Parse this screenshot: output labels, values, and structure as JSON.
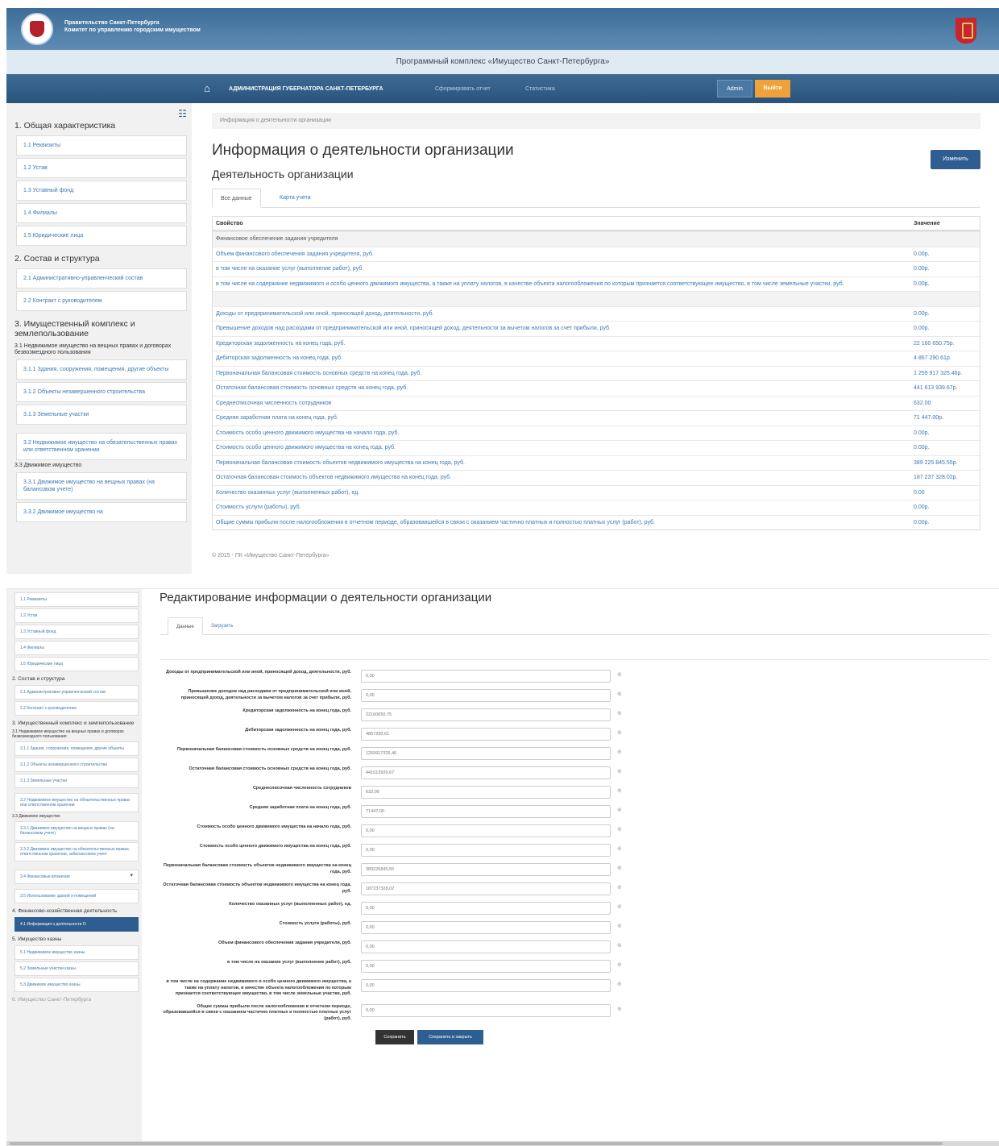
{
  "header": {
    "gov_line1": "Правительство Санкт-Петербурга",
    "gov_line2": "Комитет по управлению городским имуществом",
    "app_title": "Программный комплекс «Имущество Санкт-Петербурга»"
  },
  "nav": {
    "org": "АДМИНИСТРАЦИЯ ГУБЕРНАТОРА САНКТ-ПЕТЕРБУРГА",
    "link1": "Сформировать отчет",
    "link2": "Статистика",
    "admin": "Admin",
    "logout": "Выйти"
  },
  "sidebar": {
    "s1": "1. Общая характеристика",
    "s1_items": [
      "1.1 Реквизиты",
      "1.2 Устав",
      "1.3 Уставный фонд",
      "1.4 Филиалы",
      "1.5 Юридические лица"
    ],
    "s2": "2. Состав и структура",
    "s2_items": [
      "2.1 Административно-управленческий состав",
      "2.2 Контракт с руководителем"
    ],
    "s3": "3. Имущественный комплекс и землепользование",
    "s3_sub": "3.1 Недвижимое имущество на вещных правах и договорах безвозмездного пользования",
    "s3_items": [
      "3.1.1 Здания, сооружения, помещения, другие объекты",
      "3.1.2 Объекты незавершенного строительства",
      "3.1.3 Земельные участки"
    ],
    "s3_2": "3.2 Недвижимое имущество на обязательственных правах или ответственном хранении",
    "s3_3": "3.3 Движимое имущество",
    "s3_3_items": [
      "3.3.1 Движимое имущество на вещных правах (на балансовом учете)",
      "3.3.2 Движимое имущество на"
    ]
  },
  "main": {
    "breadcrumb": "Информация о деятельности организации",
    "title": "Информация о деятельности организации",
    "edit_button": "Изменить",
    "subtitle": "Деятельность организации",
    "tab_all": "Все данные",
    "tab_card": "Карта учета",
    "col_prop": "Свойство",
    "col_val": "Значение",
    "rows": [
      {
        "p": "Финансовое обеспечение задания учредителя",
        "v": "",
        "group": true
      },
      {
        "p": "Объем финансового обеспечения задания учредителя, руб.",
        "v": "0.00р."
      },
      {
        "p": "в том числе на оказание услуг (выполнение работ), руб.",
        "v": "0.00р."
      },
      {
        "p": "в том числе на содержание недвижимого и особо ценного движимого имущества, а также на уплату налогов, в качестве объекта налогообложения по которым признается соответствующее имущество, в том числе земельные участки, руб.",
        "v": "0.00р."
      },
      {
        "p": "",
        "v": "",
        "group": true
      },
      {
        "p": "Доходы от предпринимательской или иной, приносящей доход, деятельности, руб.",
        "v": "0.00р."
      },
      {
        "p": "Превышение доходов над расходами от предпринимательской или иной, приносящей доход, деятельности за вычетом налогов за счет прибыли, руб.",
        "v": "0.00р."
      },
      {
        "p": "Кредиторская задолженность на конец года, руб.",
        "v": "22 160 650.75р."
      },
      {
        "p": "Дебиторская задолженность на конец года, руб.",
        "v": "4 867 290.61р."
      },
      {
        "p": "Первоначальная балансовая стоимость основных средств на конец года, руб.",
        "v": "1 259 917 325.46р."
      },
      {
        "p": "Остаточная балансовая стоимость основных средств на конец года, руб.",
        "v": "441 613 939.67р."
      },
      {
        "p": "Среднесписочная численность сотрудников",
        "v": "632.00"
      },
      {
        "p": "Средняя заработная плата на конец года, руб.",
        "v": "71 447.00р."
      },
      {
        "p": "Стоимость особо ценного движимого имущества на начало года, руб.",
        "v": "0.00р."
      },
      {
        "p": "Стоимость особо ценного движимого имущества на конец года, руб.",
        "v": "0.00р."
      },
      {
        "p": "Первоначальная балансовая стоимость объектов недвижимого имущества на конец года, руб.",
        "v": "389 225 845.55р."
      },
      {
        "p": "Остаточная балансовая стоимость объектов недвижимого имущества на конец года, руб.",
        "v": "187 237 328.02р."
      },
      {
        "p": "Количество оказанных услуг (выполненных работ), ед.",
        "v": "0.00"
      },
      {
        "p": "Стоимость услуги (работы), руб.",
        "v": "0.00р."
      },
      {
        "p": "Общие суммы прибыли после налогообложения в отчетном периоде, образовавшейся в связи с оказанием частично платных и полностью платных услуг (работ), руб.",
        "v": "0.00р."
      }
    ],
    "footer": "© 2015 - ПК «Имущество Санкт-Петербурга»"
  },
  "sidebar2": {
    "s1_items": [
      "1.1 Реквизиты",
      "1.2 Устав",
      "1.3 Уставный фонд",
      "1.4 Филиалы",
      "1.5 Юридические лица"
    ],
    "s2": "2. Состав и структура",
    "s2_items": [
      "2.1 Административно-управленческий состав",
      "2.2 Контракт с руководителем"
    ],
    "s3": "3. Имущественный комплекс и землепользование",
    "s3_sub": "3.1 Недвижимое имущество на вещных правах и договорах безвозмездного пользования",
    "s3_items": [
      "3.1.1 Здания, сооружения, помещения, другие объекты",
      "3.1.2 Объекты незавершенного строительства",
      "3.1.3 Земельные участки"
    ],
    "s3_2": "3.2 Недвижимое имущество на обязательственных правах или ответственном хранении",
    "s3_3": "3.3 Движимое имущество",
    "s3_3_items": [
      "3.3.1 Движимое имущество на вещных правах (на балансовом учете)",
      "3.3.2 Движимое имущество на обязательственных правах, ответственном хранении, забалансовом учете"
    ],
    "s3_4": "3.4 Финансовые вложения",
    "s3_5": "3.5 Использование зданий и помещений",
    "s4": "4. Финансово-хозяйственная деятельность",
    "s4_active": "4.1 Информация о деятельности О",
    "s5": "5. Имущество казны",
    "s5_items": [
      "5.1 Недвижимое имущество казны",
      "5.2 Земельные участки казны",
      "5.3 Движимое имущество казны"
    ],
    "cut": "6. Имущество Санкт-Петербурга"
  },
  "form": {
    "title": "Редактирование информации о деятельности организации",
    "tab_main": "Данные",
    "tab_upload": "Загрузить",
    "fields": [
      {
        "label": "Доходы от предпринимательской или иной, приносящей доход, деятельности, руб.",
        "value": "0,00"
      },
      {
        "label": "Превышение доходов над расходами от предпринимательской или иной, приносящей доход, деятельности за вычетом налогов за счет прибыли, руб.",
        "value": "0,00"
      },
      {
        "label": "Кредиторская задолженность на конец года, руб.",
        "value": "22160650,75"
      },
      {
        "label": "Дебиторская задолженность на конец года, руб.",
        "value": "4867290,61"
      },
      {
        "label": "Первоначальная балансовая стоимость основных средств на конец года, руб.",
        "value": "1259917325,46"
      },
      {
        "label": "Остаточная балансовая стоимость основных средств на конец года, руб.",
        "value": "441613939,67"
      },
      {
        "label": "Среднесписочная численность сотрудников",
        "value": "632,00"
      },
      {
        "label": "Средняя заработная плата на конец года, руб.",
        "value": "71447,00"
      },
      {
        "label": "Стоимость особо ценного движимого имущества на начало года, руб.",
        "value": "0,00"
      },
      {
        "label": "Стоимость особо ценного движимого имущества на конец года, руб.",
        "value": "0,00"
      },
      {
        "label": "Первоначальная балансовая стоимость объектов недвижимого имущества на конец года, руб.",
        "value": "389225845,55"
      },
      {
        "label": "Остаточная балансовая стоимость объектов недвижимого имущества на конец года, руб.",
        "value": "187237328,02"
      },
      {
        "label": "Количество оказанных услуг (выполненных работ), ед.",
        "value": "0,00"
      },
      {
        "label": "Стоимость услуги (работы), руб.",
        "value": "0,00"
      },
      {
        "label": "Объем финансового обеспечения задания учредителя, руб.",
        "value": "0,00"
      },
      {
        "label": "в том числе на оказание услуг (выполнение работ), руб.",
        "value": "0,00"
      },
      {
        "label": "в том числе на содержание недвижимого и особо ценного движимого имущества, а также на уплату налогов, в качестве объекта налогообложения по которым признается соответствующее имущество, в том числе земельные участки, руб.",
        "value": "0,00"
      },
      {
        "label": "Общие суммы прибыли после налогообложения в отчетном периоде, образовавшейся в связи с оказанием частично платных и полностью платных услуг (работ), руб.",
        "value": "0,00"
      }
    ],
    "save": "Сохранить",
    "save_close": "Сохранить и закрыть"
  }
}
